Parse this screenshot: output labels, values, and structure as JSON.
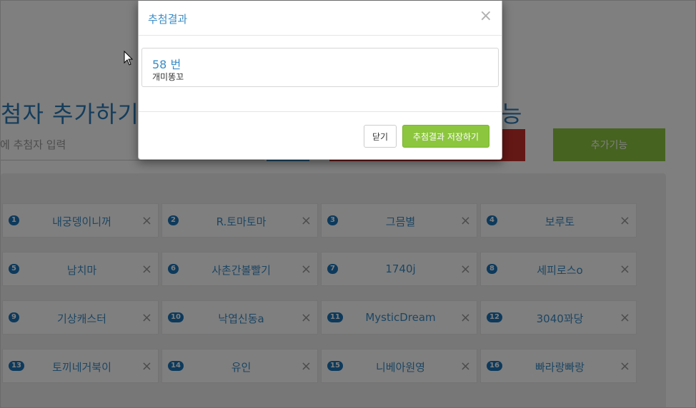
{
  "background": {
    "title_left": "첨자 추가하기",
    "title_right": "능",
    "input_placeholder": "에 추첨자 입력",
    "extra_button_label": "추가기능",
    "participants": [
      {
        "num": "1",
        "name": "내궁뎅이니꺼"
      },
      {
        "num": "2",
        "name": "R.토마토마"
      },
      {
        "num": "3",
        "name": "그믐별"
      },
      {
        "num": "4",
        "name": "보루토"
      },
      {
        "num": "5",
        "name": "남치마"
      },
      {
        "num": "6",
        "name": "사촌간볼빨기"
      },
      {
        "num": "7",
        "name": "1740j"
      },
      {
        "num": "8",
        "name": "세피로스o"
      },
      {
        "num": "9",
        "name": "기상캐스터"
      },
      {
        "num": "10",
        "name": "낙엽신동a"
      },
      {
        "num": "11",
        "name": "MysticDream"
      },
      {
        "num": "12",
        "name": "3040꽈당"
      },
      {
        "num": "13",
        "name": "토끼네거북이"
      },
      {
        "num": "14",
        "name": "유인"
      },
      {
        "num": "15",
        "name": "니베아원영"
      },
      {
        "num": "16",
        "name": "빠라랑빠랑"
      }
    ],
    "remove_glyph": "×"
  },
  "modal": {
    "title": "추첨결과",
    "close_glyph": "×",
    "result_number": "58 번",
    "result_name": "개미똥꼬",
    "close_button_label": "닫기",
    "save_button_label": "추첨결과 저장하기"
  },
  "colors": {
    "accent_blue": "#3a8cc6",
    "accent_green": "#8cc63f",
    "danger_red": "#c9302c",
    "badge_blue": "#1b74b9"
  }
}
